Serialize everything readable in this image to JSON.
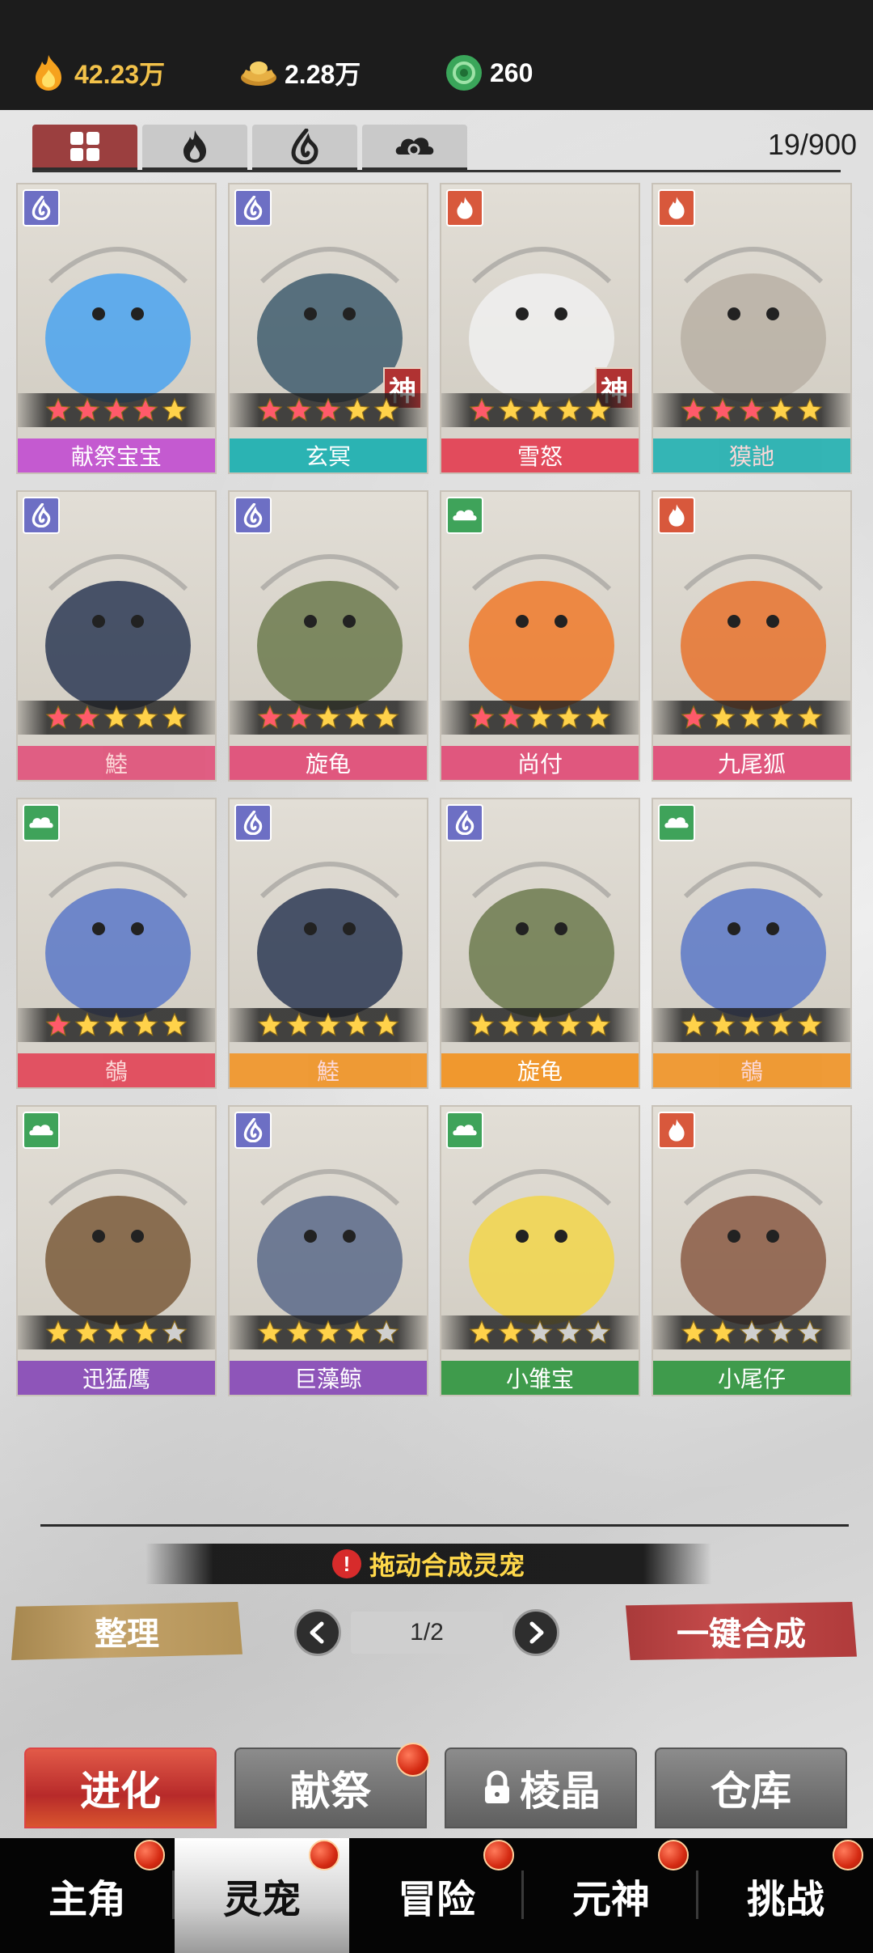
{
  "resources": {
    "flame": "42.23万",
    "gold": "2.28万",
    "jade": "260"
  },
  "filters": [
    {
      "name": "all",
      "icon": "grid-icon"
    },
    {
      "name": "fire",
      "icon": "fire-element-icon"
    },
    {
      "name": "water",
      "icon": "water-element-icon"
    },
    {
      "name": "wind",
      "icon": "cloud-element-icon"
    }
  ],
  "pet_count": "19/900",
  "colors": {
    "fire": "#d8583c",
    "water": "#6d6fc4",
    "wind": "#3fa35a",
    "star_on": "#ffd24a",
    "star_off": "#cfcfcf",
    "accent_red": "#c44a4a"
  },
  "pets": [
    {
      "name": "献祭宝宝",
      "element": "water",
      "stars": 5,
      "red_stars": 4,
      "quality": "q-purple",
      "shen": false
    },
    {
      "name": "玄冥",
      "element": "water",
      "stars": 5,
      "red_stars": 3,
      "quality": "q-teal",
      "shen": true,
      "shen_label": "神"
    },
    {
      "name": "雪怒",
      "element": "fire",
      "stars": 5,
      "red_stars": 1,
      "quality": "q-red",
      "shen": true,
      "shen_label": "神"
    },
    {
      "name": "獏訑",
      "element": "fire",
      "stars": 5,
      "red_stars": 3,
      "quality": "q-teal",
      "shen": false,
      "dim": true
    },
    {
      "name": "鯥",
      "element": "water",
      "stars": 5,
      "red_stars": 2,
      "quality": "q-pink",
      "shen": false,
      "dim": true
    },
    {
      "name": "旋龟",
      "element": "water",
      "stars": 5,
      "red_stars": 2,
      "quality": "q-pink",
      "shen": false
    },
    {
      "name": "尚付",
      "element": "wind",
      "stars": 5,
      "red_stars": 2,
      "quality": "q-pink",
      "shen": false
    },
    {
      "name": "九尾狐",
      "element": "fire",
      "stars": 5,
      "red_stars": 1,
      "quality": "q-pink",
      "shen": false
    },
    {
      "name": "鵸",
      "element": "wind",
      "stars": 5,
      "red_stars": 1,
      "quality": "q-red",
      "shen": false,
      "dim": true
    },
    {
      "name": "鯥",
      "element": "water",
      "stars": 5,
      "red_stars": 0,
      "quality": "q-orange",
      "shen": false,
      "dim": true
    },
    {
      "name": "旋龟",
      "element": "water",
      "stars": 5,
      "red_stars": 0,
      "quality": "q-orange",
      "shen": false
    },
    {
      "name": "鵸",
      "element": "wind",
      "stars": 5,
      "red_stars": 0,
      "quality": "q-orange",
      "shen": false,
      "dim": true
    },
    {
      "name": "迅猛鹰",
      "element": "wind",
      "stars": 4,
      "red_stars": 0,
      "quality": "q-violet",
      "shen": false
    },
    {
      "name": "巨藻鲸",
      "element": "water",
      "stars": 4,
      "red_stars": 0,
      "quality": "q-violet",
      "shen": false
    },
    {
      "name": "小雏宝",
      "element": "wind",
      "stars": 2,
      "red_stars": 0,
      "quality": "q-green",
      "shen": false
    },
    {
      "name": "小尾仔",
      "element": "fire",
      "stars": 2,
      "red_stars": 0,
      "quality": "q-green",
      "shen": false
    }
  ],
  "hint": "拖动合成灵宠",
  "hint_icon": "!",
  "buttons": {
    "sort": "整理",
    "merge": "一键合成"
  },
  "pager": {
    "label": "1/2"
  },
  "actions": [
    {
      "label": "进化",
      "active": true,
      "dot": false,
      "lock": false
    },
    {
      "label": "献祭",
      "active": false,
      "dot": true,
      "lock": false
    },
    {
      "label": "棱晶",
      "active": false,
      "dot": false,
      "lock": true
    },
    {
      "label": "仓库",
      "active": false,
      "dot": false,
      "lock": false
    }
  ],
  "nav": [
    {
      "label": "主角",
      "active": false
    },
    {
      "label": "灵宠",
      "active": true
    },
    {
      "label": "冒险",
      "active": false
    },
    {
      "label": "元神",
      "active": false
    },
    {
      "label": "挑战",
      "active": false
    }
  ]
}
